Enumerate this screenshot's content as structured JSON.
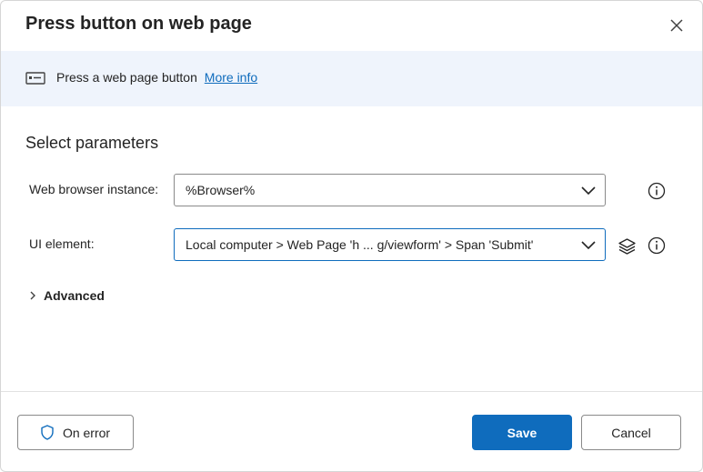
{
  "dialog": {
    "title": "Press button on web page"
  },
  "banner": {
    "text": "Press a web page button",
    "link_text": "More info"
  },
  "parameters": {
    "section_title": "Select parameters",
    "browser_instance": {
      "label": "Web browser instance:",
      "value": "%Browser%"
    },
    "ui_element": {
      "label": "UI element:",
      "value": "Local computer > Web Page 'h ... g/viewform' > Span 'Submit'"
    },
    "advanced_label": "Advanced"
  },
  "footer": {
    "on_error_label": "On error",
    "save_label": "Save",
    "cancel_label": "Cancel"
  },
  "colors": {
    "accent": "#0f6cbd",
    "banner_bg": "#eff4fc"
  },
  "icons": {
    "close": "close-icon",
    "banner": "button-icon",
    "info": "info-icon",
    "layers": "layers-icon",
    "chevron_down": "chevron-down-icon",
    "chevron_right": "chevron-right-icon",
    "shield": "shield-icon"
  }
}
